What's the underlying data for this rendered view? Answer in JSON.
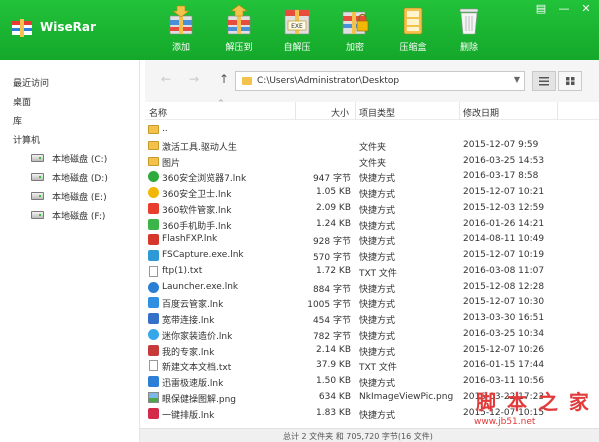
{
  "app": {
    "title": "WiseRar"
  },
  "toolbar": [
    {
      "label": "添加",
      "icon": "add-archive-icon"
    },
    {
      "label": "解压到",
      "icon": "extract-to-icon"
    },
    {
      "label": "自解压",
      "icon": "self-extract-icon"
    },
    {
      "label": "加密",
      "icon": "encrypt-icon"
    },
    {
      "label": "压缩盒",
      "icon": "compress-box-icon"
    },
    {
      "label": "删除",
      "icon": "delete-icon"
    }
  ],
  "sidebar": {
    "recent": "最近访问",
    "desktop": "桌面",
    "library": "库",
    "computer": "计算机",
    "drives": [
      "本地磁盘 (C:)",
      "本地磁盘 (D:)",
      "本地磁盘 (E:)",
      "本地磁盘 (F:)"
    ]
  },
  "address": {
    "path": "C:\\Users\\Administrator\\Desktop"
  },
  "columns": {
    "name": "名称",
    "size": "大小",
    "type": "项目类型",
    "date": "修改日期"
  },
  "files": [
    {
      "name": "..",
      "size": "",
      "type": "",
      "date": "",
      "icon": "folder",
      "color": "#f2c24d"
    },
    {
      "name": "激活工具.驱动人生",
      "size": "",
      "type": "文件夹",
      "date": "2015-12-07 9:59",
      "icon": "folder",
      "color": "#f2c24d"
    },
    {
      "name": "图片",
      "size": "",
      "type": "文件夹",
      "date": "2016-03-25 14:53",
      "icon": "folder",
      "color": "#f2c24d"
    },
    {
      "name": "360安全浏览器7.lnk",
      "size": "947 字节",
      "type": "快捷方式",
      "date": "2016-03-17 8:58",
      "icon": "round",
      "color": "#2eaa3c"
    },
    {
      "name": "360安全卫士.lnk",
      "size": "1.05 KB",
      "type": "快捷方式",
      "date": "2015-12-07 10:21",
      "icon": "round",
      "color": "#f2b705"
    },
    {
      "name": "360软件管家.lnk",
      "size": "2.09 KB",
      "type": "快捷方式",
      "date": "2015-12-03 12:59",
      "icon": "square",
      "color": "#e83c2c"
    },
    {
      "name": "360手机助手.lnk",
      "size": "1.24 KB",
      "type": "快捷方式",
      "date": "2016-01-26 14:21",
      "icon": "square",
      "color": "#3cb44a"
    },
    {
      "name": "FlashFXP.lnk",
      "size": "928 字节",
      "type": "快捷方式",
      "date": "2014-08-11 10:49",
      "icon": "square",
      "color": "#d6372b"
    },
    {
      "name": "FSCapture.exe.lnk",
      "size": "570 字节",
      "type": "快捷方式",
      "date": "2015-12-07 10:19",
      "icon": "square",
      "color": "#2d9ad6"
    },
    {
      "name": "ftp(1).txt",
      "size": "1.72 KB",
      "type": "TXT 文件",
      "date": "2016-03-08 11:07",
      "icon": "doc",
      "color": "#ffffff"
    },
    {
      "name": "Launcher.exe.lnk",
      "size": "884 字节",
      "type": "快捷方式",
      "date": "2015-12-08 12:28",
      "icon": "round",
      "color": "#2a7fd4"
    },
    {
      "name": "百度云管家.lnk",
      "size": "1005 字节",
      "type": "快捷方式",
      "date": "2015-12-07 10:30",
      "icon": "square",
      "color": "#2f8fe0"
    },
    {
      "name": "宽带连接.lnk",
      "size": "454 字节",
      "type": "快捷方式",
      "date": "2013-03-30 16:51",
      "icon": "square",
      "color": "#3570c8"
    },
    {
      "name": "迷你家装造价.lnk",
      "size": "782 字节",
      "type": "快捷方式",
      "date": "2016-03-25 10:34",
      "icon": "round",
      "color": "#35a7e8"
    },
    {
      "name": "我的专家.lnk",
      "size": "2.14 KB",
      "type": "快捷方式",
      "date": "2015-12-07 10:26",
      "icon": "square",
      "color": "#c63a3a"
    },
    {
      "name": "新建文本文档.txt",
      "size": "37.9 KB",
      "type": "TXT 文件",
      "date": "2016-01-15 17:44",
      "icon": "doc",
      "color": "#ffffff"
    },
    {
      "name": "迅雷极速版.lnk",
      "size": "1.50 KB",
      "type": "快捷方式",
      "date": "2016-03-11 10:56",
      "icon": "square",
      "color": "#2c7ed6"
    },
    {
      "name": "眼保健操图解.png",
      "size": "634 KB",
      "type": "NkImageViewPic.png",
      "date": "2016-03-22 17:23",
      "icon": "image",
      "color": "#7ab8e8"
    },
    {
      "name": "一键排版.lnk",
      "size": "1.83 KB",
      "type": "快捷方式",
      "date": "2015-12-07 10:15",
      "icon": "square",
      "color": "#d42a4a"
    }
  ],
  "status": {
    "text": "总计 2 文件夹 和 705,720 字节(16 文件)"
  },
  "watermark": {
    "main": "脚 本 之 家",
    "url": "www.jb51.net"
  }
}
